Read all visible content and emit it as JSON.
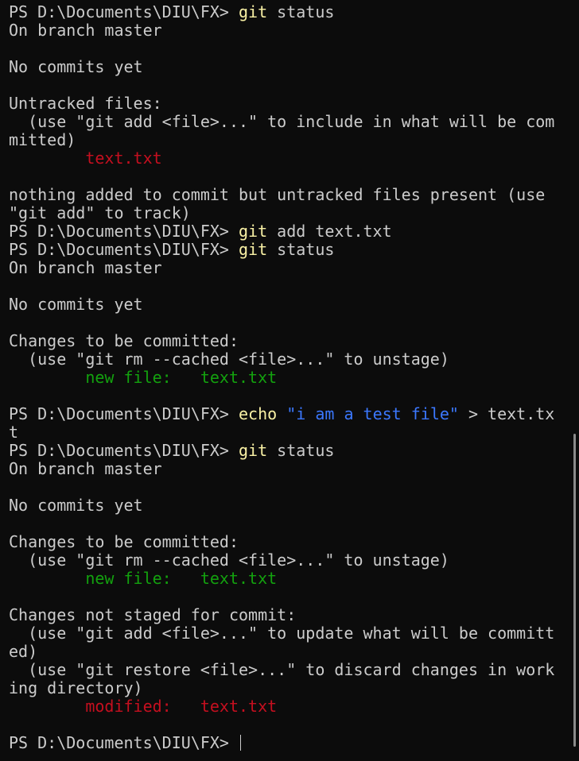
{
  "prompt": "PS D:\\Documents\\DIU\\FX> ",
  "lines": [
    {
      "type": "cmd",
      "cmd": "git",
      "args": " status"
    },
    {
      "type": "out",
      "text": "On branch master"
    },
    {
      "type": "blank"
    },
    {
      "type": "out",
      "text": "No commits yet"
    },
    {
      "type": "blank"
    },
    {
      "type": "out",
      "text": "Untracked files:"
    },
    {
      "type": "out",
      "text": "  (use \"git add <file>...\" to include in what will be com"
    },
    {
      "type": "out",
      "text": "mitted)"
    },
    {
      "type": "out",
      "text": "        text.txt",
      "color": "red"
    },
    {
      "type": "blank"
    },
    {
      "type": "out",
      "text": "nothing added to commit but untracked files present (use"
    },
    {
      "type": "out",
      "text": "\"git add\" to track)"
    },
    {
      "type": "cmd",
      "cmd": "git",
      "args": " add text.txt"
    },
    {
      "type": "cmd",
      "cmd": "git",
      "args": " status"
    },
    {
      "type": "out",
      "text": "On branch master"
    },
    {
      "type": "blank"
    },
    {
      "type": "out",
      "text": "No commits yet"
    },
    {
      "type": "blank"
    },
    {
      "type": "out",
      "text": "Changes to be committed:"
    },
    {
      "type": "out",
      "text": "  (use \"git rm --cached <file>...\" to unstage)"
    },
    {
      "type": "out",
      "text": "        new file:   text.txt",
      "color": "green"
    },
    {
      "type": "blank"
    },
    {
      "type": "cmd",
      "cmd": "echo",
      "str": " \"i am a test file\"",
      "args": " > text.tx"
    },
    {
      "type": "out",
      "text": "t"
    },
    {
      "type": "cmd",
      "cmd": "git",
      "args": " status"
    },
    {
      "type": "out",
      "text": "On branch master"
    },
    {
      "type": "blank"
    },
    {
      "type": "out",
      "text": "No commits yet"
    },
    {
      "type": "blank"
    },
    {
      "type": "out",
      "text": "Changes to be committed:"
    },
    {
      "type": "out",
      "text": "  (use \"git rm --cached <file>...\" to unstage)"
    },
    {
      "type": "out",
      "text": "        new file:   text.txt",
      "color": "green"
    },
    {
      "type": "blank"
    },
    {
      "type": "out",
      "text": "Changes not staged for commit:"
    },
    {
      "type": "out",
      "text": "  (use \"git add <file>...\" to update what will be committ"
    },
    {
      "type": "out",
      "text": "ed)"
    },
    {
      "type": "out",
      "text": "  (use \"git restore <file>...\" to discard changes in work"
    },
    {
      "type": "out",
      "text": "ing directory)"
    },
    {
      "type": "out",
      "text": "        modified:   text.txt",
      "color": "red"
    },
    {
      "type": "blank"
    },
    {
      "type": "input"
    }
  ],
  "colors": {
    "background": "#0c0c0c",
    "foreground": "#cccccc",
    "command": "#f9f1a5",
    "string": "#3b78ff",
    "red": "#c50f1f",
    "green": "#13a10e"
  }
}
